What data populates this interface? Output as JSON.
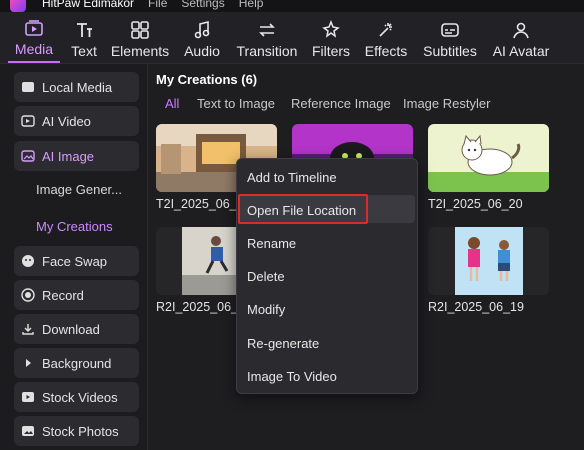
{
  "titlebar": {
    "app_name": "HitPaw Edimakor",
    "menu": [
      "File",
      "Settings",
      "Help"
    ]
  },
  "toolbar": {
    "tabs": [
      {
        "label": "Media",
        "icon": "media-icon",
        "active": true
      },
      {
        "label": "Text",
        "icon": "text-icon"
      },
      {
        "label": "Elements",
        "icon": "elements-icon"
      },
      {
        "label": "Audio",
        "icon": "audio-icon"
      },
      {
        "label": "Transition",
        "icon": "transition-icon"
      },
      {
        "label": "Filters",
        "icon": "filters-icon"
      },
      {
        "label": "Effects",
        "icon": "effects-icon"
      },
      {
        "label": "Subtitles",
        "icon": "subtitles-icon"
      },
      {
        "label": "AI Avatar",
        "icon": "avatar-icon"
      }
    ]
  },
  "sidebar": {
    "items": [
      {
        "label": "Local Media",
        "icon": "folder-icon"
      },
      {
        "label": "AI Video",
        "icon": "ai-video-icon"
      },
      {
        "label": "AI Image",
        "icon": "ai-image-icon",
        "active": true
      },
      {
        "label": "Image Gener...",
        "sub": true
      },
      {
        "label": "My Creations",
        "sub": true,
        "active": true
      },
      {
        "label": "Face Swap",
        "icon": "face-swap-icon"
      },
      {
        "label": "Record",
        "icon": "record-icon"
      },
      {
        "label": "Download",
        "icon": "download-icon"
      },
      {
        "label": "Background",
        "icon": "play-icon"
      },
      {
        "label": "Stock Videos",
        "icon": "stock-videos-icon"
      },
      {
        "label": "Stock Photos",
        "icon": "stock-photos-icon"
      }
    ]
  },
  "main": {
    "title": "My Creations (6)",
    "tabs": [
      "All",
      "Text to Image",
      "Reference Image",
      "Image Restyler"
    ],
    "active_tab": "All",
    "thumbnails": [
      {
        "label": "T2I_2025_06_24"
      },
      {
        "label": ""
      },
      {
        "label": "T2I_2025_06_20"
      },
      {
        "label": "R2I_2025_06_19"
      },
      {
        "label": ""
      },
      {
        "label": "R2I_2025_06_19"
      }
    ]
  },
  "context_menu": {
    "items": [
      "Add to Timeline",
      "Open File Location",
      "Rename",
      "Delete",
      "Modify",
      "Re-generate",
      "Image To Video"
    ],
    "highlighted": "Open File Location"
  },
  "colors": {
    "accent": "#c87cff",
    "highlight_box": "#e02a2a",
    "background": "#1e1e21"
  }
}
